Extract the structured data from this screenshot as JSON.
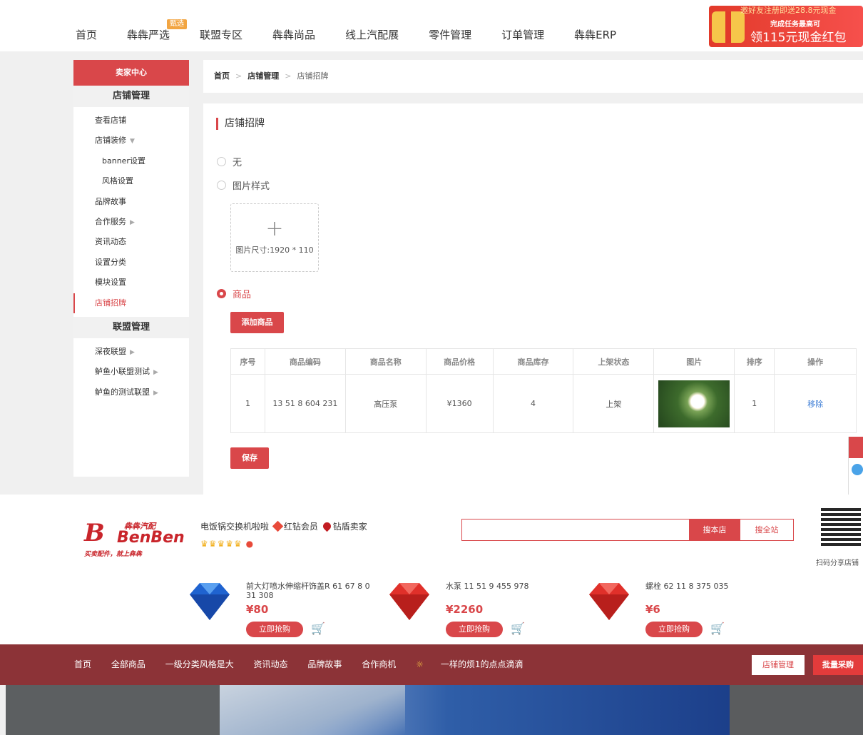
{
  "topnav": {
    "items": [
      "首页",
      "犇犇严选",
      "联盟专区",
      "犇犇尚品",
      "线上汽配展",
      "零件管理",
      "订单管理",
      "犇犇ERP"
    ],
    "tag": "甄选",
    "promo": {
      "line1": "邀好友注册即送28.8元现金",
      "line2": "完成任务最高可",
      "line3": "领115元现金红包"
    }
  },
  "sidebar": {
    "header": "卖家中心",
    "section1": "店铺管理",
    "items1": [
      {
        "label": "查看店铺"
      },
      {
        "label": "店铺装修",
        "caret": "▼"
      },
      {
        "label": "banner设置",
        "sub": true
      },
      {
        "label": "风格设置",
        "sub": true
      },
      {
        "label": "品牌故事"
      },
      {
        "label": "合作服务",
        "caret": "▶"
      },
      {
        "label": "资讯动态"
      },
      {
        "label": "设置分类"
      },
      {
        "label": "模块设置"
      },
      {
        "label": "店铺招牌",
        "active": true
      }
    ],
    "section2": "联盟管理",
    "items2": [
      {
        "label": "深夜联盟",
        "caret": "▶"
      },
      {
        "label": "鲈鱼小联盟测试",
        "caret": "▶"
      },
      {
        "label": "鲈鱼的测试联盟",
        "caret": "▶"
      }
    ]
  },
  "breadcrumb": {
    "home": "首页",
    "parent": "店铺管理",
    "current": "店铺招牌",
    "sep": ">"
  },
  "main": {
    "title": "店铺招牌",
    "options": [
      "无",
      "图片样式",
      "商品"
    ],
    "selected": "商品",
    "upload": {
      "plus": "+",
      "hint": "图片尺寸:1920 * 110"
    },
    "add_button": "添加商品",
    "save_button": "保存",
    "table": {
      "headers": [
        "序号",
        "商品编码",
        "商品名称",
        "商品价格",
        "商品库存",
        "上架状态",
        "图片",
        "排序",
        "操作"
      ],
      "rows": [
        {
          "index": "1",
          "code": "13 51 8 604 231",
          "name": "高压泵",
          "price": "¥1360",
          "stock": "4",
          "status": "上架",
          "sort": "1",
          "action": "移除"
        }
      ]
    }
  },
  "shop": {
    "logo": {
      "cn": "犇犇汽配",
      "en": "BenBen",
      "mark": "B",
      "slogan": "买卖配件，就上犇犇"
    },
    "name": "电饭锅交换机啦啦",
    "badge1": "红钻会员",
    "badge2": "钻盾卖家",
    "crowns": "♛♛♛♛♛",
    "search_store": "搜本店",
    "search_all": "搜全站",
    "qr_label": "扫码分享店铺",
    "products": [
      {
        "name": "前大灯喷水伸缩杆饰盖R 61 67 8 0 31 308",
        "price": "¥80",
        "buy": "立即抢购",
        "color": "#2a6fd6"
      },
      {
        "name": "水泵 11 51 9 455 978",
        "price": "¥2260",
        "buy": "立即抢购",
        "color": "#e0302a"
      },
      {
        "name": "螺栓 62 11 8 375 035",
        "price": "¥6",
        "buy": "立即抢购",
        "color": "#e0302a"
      }
    ]
  },
  "shopnav": {
    "items": [
      "首页",
      "全部商品",
      "一级分类风格是大",
      "资讯动态",
      "品牌故事",
      "合作商机"
    ],
    "notice": "一样的烦1的点点滴滴",
    "manage": "店铺管理",
    "batch": "批量采购"
  },
  "colors": {
    "accent": "#d9474a",
    "nav_bg": "#8c3337"
  }
}
